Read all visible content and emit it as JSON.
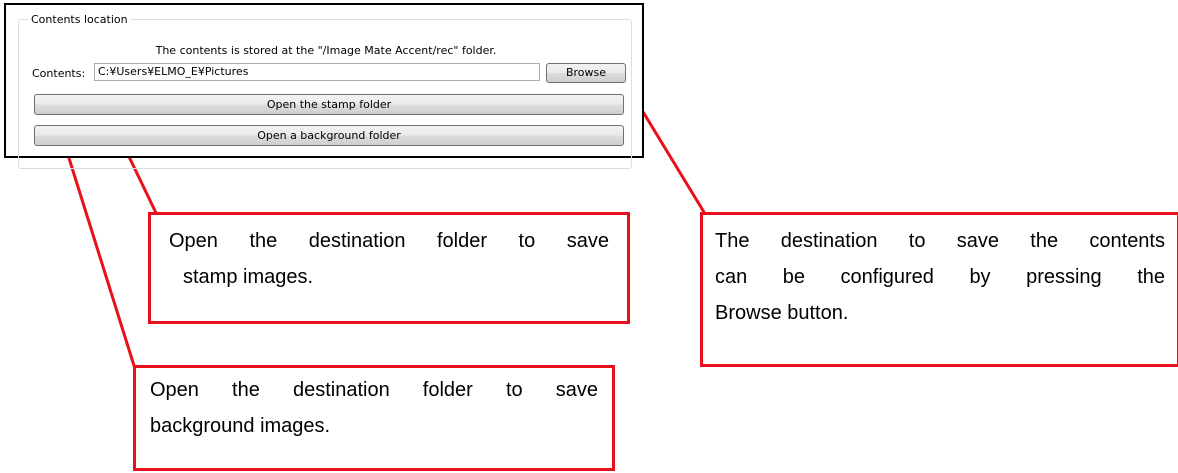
{
  "panel": {
    "group_title": "Contents location",
    "info_text": "The contents is stored at the \"/Image Mate Accent/rec\" folder.",
    "contents_label": "Contents:",
    "contents_path": "C:¥Users¥ELMO_E¥Pictures",
    "browse_label": "Browse",
    "stamp_folder_label": "Open the stamp folder",
    "background_folder_label": "Open a background folder"
  },
  "callouts": {
    "stamp": {
      "line1": "Open the destination folder to save",
      "line2": "stamp images."
    },
    "browse": {
      "line1": "The destination to save the contents",
      "line2": "can be configured by pressing the",
      "line3": "Browse button."
    },
    "background": {
      "line1": "Open the destination folder to save",
      "line2": "background images."
    }
  },
  "colors": {
    "callout_border": "#e8101a",
    "leader_line": "#e8101a"
  }
}
